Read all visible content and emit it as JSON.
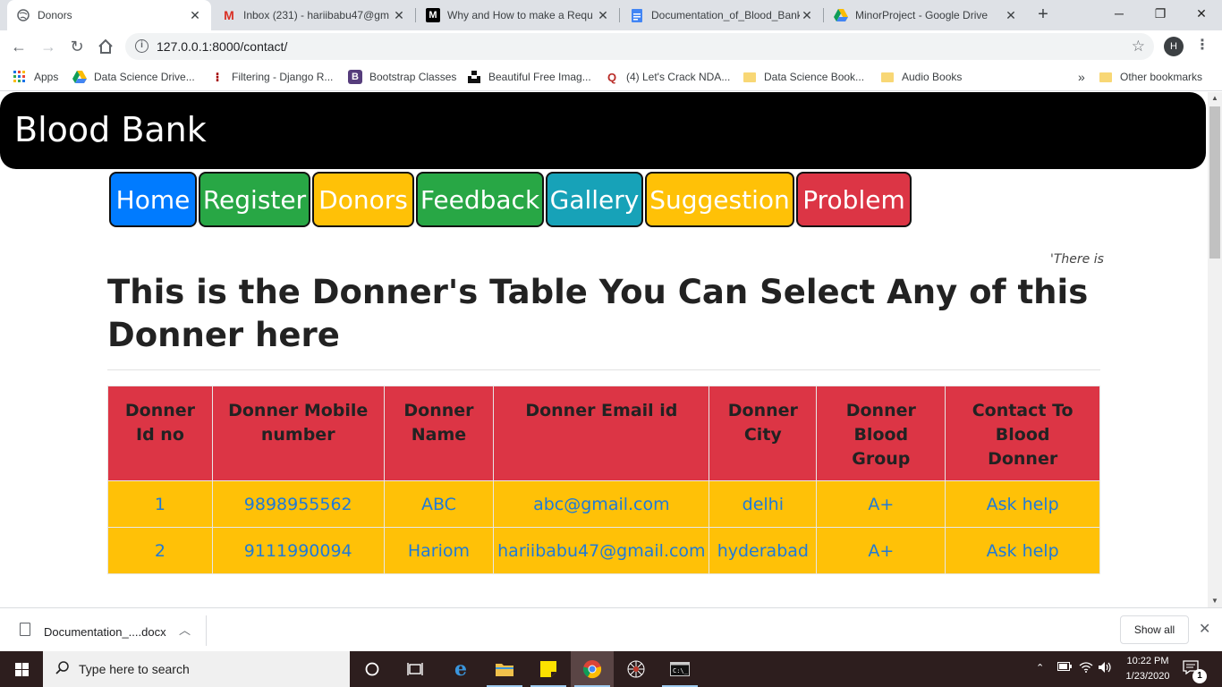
{
  "browser": {
    "tabs": [
      {
        "title": "Donors",
        "icon": "globe-icon"
      },
      {
        "title": "Inbox (231) - hariibabu47@gm",
        "icon": "gmail-icon"
      },
      {
        "title": "Why and How to make a Requ",
        "icon": "medium-icon"
      },
      {
        "title": "Documentation_of_Blood_Bank",
        "icon": "docs-icon"
      },
      {
        "title": "MinorProject - Google Drive",
        "icon": "drive-icon"
      }
    ],
    "url": "127.0.0.1:8000/contact/",
    "profile_initial": "H",
    "bookmarks": [
      {
        "label": "Apps",
        "icon": "apps-grid-icon"
      },
      {
        "label": "Data Science Drive...",
        "icon": "drive-icon"
      },
      {
        "label": "Filtering - Django R...",
        "icon": "django-icon"
      },
      {
        "label": "Bootstrap Classes",
        "icon": "bootstrap-icon"
      },
      {
        "label": "Beautiful Free Imag...",
        "icon": "unsplash-icon"
      },
      {
        "label": "(4) Let's Crack NDA...",
        "icon": "quora-icon"
      },
      {
        "label": "Data Science Book...",
        "icon": "folder-icon"
      },
      {
        "label": "Audio Books",
        "icon": "folder-icon"
      }
    ],
    "overflow": "»",
    "other_bookmarks": "Other bookmarks"
  },
  "site": {
    "brand": "Blood Bank",
    "nav": [
      {
        "label": "Home",
        "color": "#007bff"
      },
      {
        "label": "Register",
        "color": "#28a745"
      },
      {
        "label": "Donors",
        "color": "#ffc107"
      },
      {
        "label": "Feedback",
        "color": "#28a745"
      },
      {
        "label": "Gallery",
        "color": "#17a2b8"
      },
      {
        "label": "Suggestion",
        "color": "#ffc107"
      },
      {
        "label": "Problem",
        "color": "#dc3545"
      }
    ],
    "marquee": "'There is",
    "heading": "This is the Donner's Table You Can Select Any of this Donner here",
    "table": {
      "headers": [
        "Donner Id no",
        "Donner Mobile number",
        "Donner Name",
        "Donner Email id",
        "Donner City",
        "Donner Blood Group",
        "Contact To Blood Donner"
      ],
      "rows": [
        [
          "1",
          "9898955562",
          "ABC",
          "abc@gmail.com",
          "delhi",
          "A+",
          "Ask help"
        ],
        [
          "2",
          "9111990094",
          "Hariom",
          "hariibabu47@gmail.com",
          "hyderabad",
          "A+",
          "Ask help"
        ]
      ],
      "header_color": "#dc3545",
      "row_color": "#ffc107",
      "link_color": "#1f7ad8"
    }
  },
  "downloads": {
    "file": "Documentation_....docx",
    "show_all": "Show all"
  },
  "taskbar": {
    "search_placeholder": "Type here to search",
    "time": "10:22 PM",
    "date": "1/23/2020",
    "notification_count": "1"
  }
}
